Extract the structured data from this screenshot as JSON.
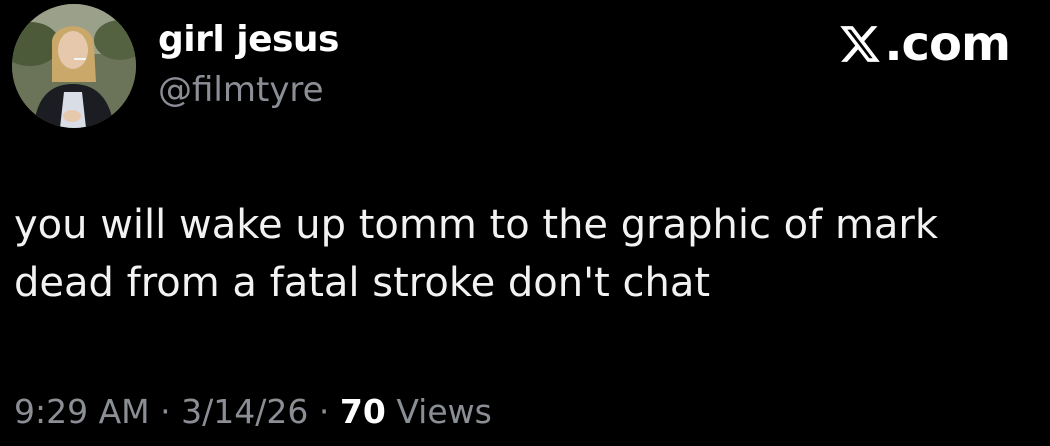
{
  "author": {
    "display_name": "girl jesus",
    "handle": "@filmtyre",
    "avatar_icon": "profile-photo-avatar"
  },
  "brand": {
    "icon": "x-logo-icon",
    "suffix": ".com"
  },
  "tweet": {
    "text_lines": [
      "you will wake up tomm to the graphic of mark",
      "dead from a fatal stroke don't chat"
    ]
  },
  "meta": {
    "time": "9:29 AM",
    "separator": "·",
    "date": "3/14/26",
    "views_count": "70",
    "views_label": "Views"
  },
  "colors": {
    "background": "#000000",
    "primary_text": "#ffffff",
    "secondary_text": "#8b8f95"
  }
}
